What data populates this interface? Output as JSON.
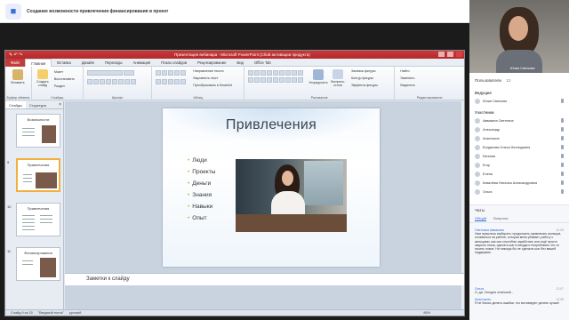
{
  "meeting": {
    "title": "Создание возможности привлечения финансирования в проект"
  },
  "ppt": {
    "window_title": "Презентация вебинара  -  Microsoft PowerPoint (Сбой активации продукта)",
    "tabs": [
      "Файл",
      "Главная",
      "Вставка",
      "Дизайн",
      "Переходы",
      "Анимация",
      "Показ слайдов",
      "Рецензирование",
      "Вид",
      "Office Tab"
    ],
    "active_tab": "Главная",
    "ribbon": {
      "paste": "Вставить",
      "create_slide": "Создать слайд",
      "layout": "Макет",
      "reset": "Восстановить",
      "section": "Раздел",
      "groups": [
        "Буфер обмена",
        "Слайды",
        "Шрифт",
        "Абзац",
        "Рисование",
        "Редактирование"
      ],
      "text_direction": "Направление текста",
      "align_text": "Выровнять текст",
      "smartart": "Преобразовать в SmartArt",
      "arrange": "Упорядочить",
      "quick_styles": "Экспресс-стили",
      "shape_fill": "Заливка фигуры",
      "shape_outline": "Контур фигуры",
      "shape_effects": "Эффекты фигуры",
      "find": "Найти",
      "replace": "Заменить",
      "select": "Выделить"
    },
    "left_panel": {
      "tabs": [
        "Слайды",
        "Структура"
      ],
      "thumbs": [
        {
          "num": "",
          "title": "Возможности"
        },
        {
          "num": "9",
          "title": "Привлечения"
        },
        {
          "num": "10",
          "title": "Привлечения"
        },
        {
          "num": "11",
          "title": "Финансирования"
        }
      ]
    },
    "slide": {
      "title": "Привлечения",
      "bullets": [
        "Люди",
        "Проекты",
        "Деньги",
        "Знания",
        "Навыки",
        "Опыт"
      ]
    },
    "notes_placeholder": "Заметки к слайду",
    "status": {
      "slide": "Слайд 9 из 15",
      "theme": "\"Вводный поток\"",
      "lang": "русский",
      "zoom": "86%"
    }
  },
  "sidebar": {
    "webcam_name": "Юлия Светкова",
    "participants_label": "Пользователи",
    "participants_count": "12",
    "hosts_label": "Ведущие",
    "host": "Юлия Светкова",
    "members_label": "Участники",
    "members": [
      "Аввакина Светлана",
      "Александр",
      "Анастасия",
      "Богданова Олеся Леонидовна",
      "Евгения",
      "Егор",
      "Елена",
      "Ковалёва Наталья Александровна",
      "Ольга"
    ],
    "chat": {
      "header": "Чаты",
      "tabs": [
        "Общий",
        "Вопросы"
      ],
      "messages": [
        {
          "author": "Светлана Аввакина",
          "time": "12:05",
          "text": "Нам пришлось выбирать: продолжать привлекать жильцов, оставаться на работе, которая меня убивает, работу с жильцами, как они способны заработать или ещё просто закрыть глаза, сделать шаг в никуда и попробовать что-то начать новое. Ни никогда бы не сделала шаг без вашей поддержки."
        },
        {
          "author": "Ольга",
          "time": "12:07",
          "text": "О, да. Сегодня отличный..."
        },
        {
          "author": "Анастасия",
          "time": "12:08",
          "text": "Я не боюсь делать ошибки, это мотивирует делать лучше!"
        }
      ],
      "input_placeholder": "Введите сообщение"
    }
  },
  "colors": {
    "ppt_red": "#c53b3b",
    "accent": "#2a6bd8",
    "bullet": "#8dc63f"
  }
}
